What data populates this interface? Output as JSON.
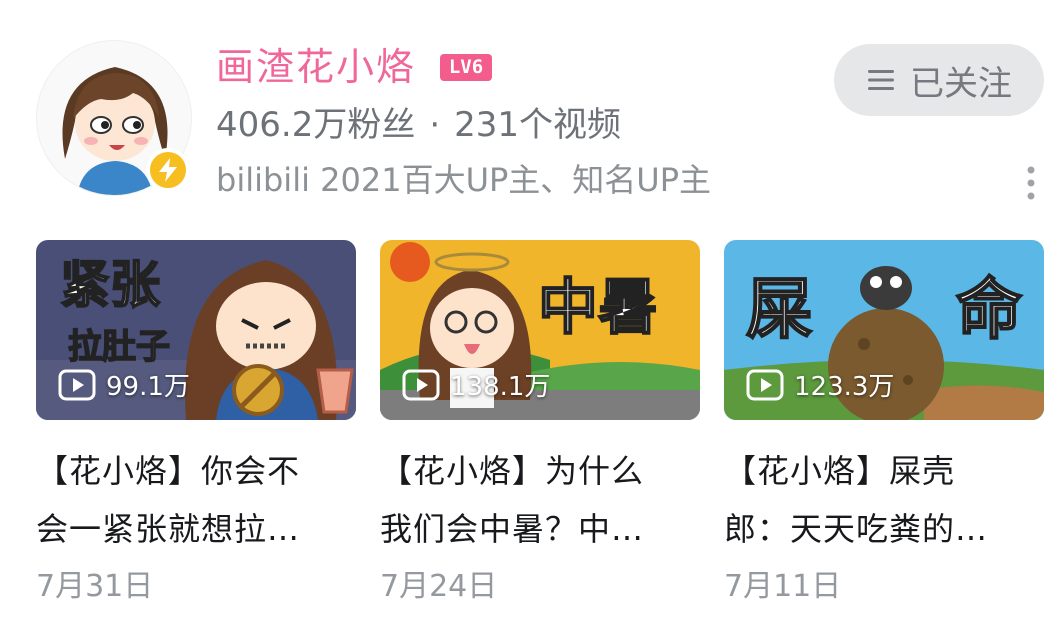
{
  "profile": {
    "name": "画渣花小烙",
    "level": "LV6",
    "followers": "406.2万粉丝",
    "separator": "·",
    "videos": "231个视频",
    "subtitle": "bilibili 2021百大UP主、知名UP主",
    "follow_button": "已关注",
    "avatar_icon": "cartoon-girl-avatar",
    "verify_icon": "lightning-bolt-icon",
    "accent_color": "#f0679a",
    "level_color": "#f25d8e"
  },
  "videos": [
    {
      "thumb_text_1": "紧张",
      "thumb_text_2": "拉肚子",
      "views": "99.1万",
      "title_line1": "【花小烙】你会不",
      "title_line2": "会一紧张就想拉…",
      "date": "7月31日"
    },
    {
      "thumb_text_1": "中暑",
      "views": "138.1万",
      "title_line1": "【花小烙】为什么",
      "title_line2": "我们会中暑？中…",
      "date": "7月24日"
    },
    {
      "thumb_text_1": "屎",
      "thumb_text_2": "命",
      "views": "123.3万",
      "title_line1": "【花小烙】屎壳",
      "title_line2": "郎：天天吃粪的…",
      "date": "7月11日"
    }
  ]
}
